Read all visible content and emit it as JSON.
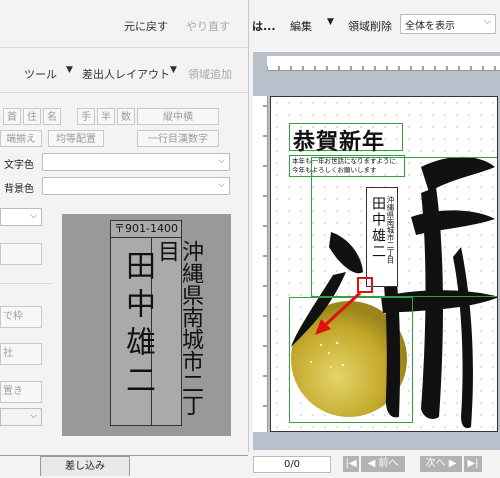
{
  "left_toolbar": {
    "undo": "元に戻す",
    "redo": "やり直す",
    "tool": "ツール",
    "sender_layout": "差出人レイアウト",
    "add_area": "領域追加"
  },
  "format_buttons": [
    "首",
    "住",
    "名",
    "手",
    "半",
    "数",
    "縦中横",
    "端揃え",
    "均等配置",
    "一行目漢数字"
  ],
  "fields": {
    "text_color": "文字色",
    "bg_color": "背景色"
  },
  "side_buttons": [
    "で枠",
    "社",
    "置き"
  ],
  "preview": {
    "zip": "〒901-1400",
    "name": "田中雄二",
    "address": "沖縄県南城市二丁目"
  },
  "bottom_tab": "差し込み",
  "right_toolbar": {
    "file_menu": "は...",
    "edit_menu": "編集",
    "delete_area": "領域削除",
    "view_select": "全体を表示"
  },
  "card_canvas": {
    "greeting_title": "恭賀新年",
    "greeting_line1": "本年も一年お世話になりますように",
    "greeting_line2": "今年もよろしくお願いします",
    "mini_name": "田中雄二",
    "mini_address": "沖縄県南城市二丁目",
    "big_char": "羊"
  },
  "pager": {
    "page": "0/0",
    "prev": "◀ 前へ",
    "next": "次へ ▶",
    "first": "|◀",
    "last": "▶|"
  },
  "colors": {
    "accent_green": "#2ea043",
    "arrow_red": "#e01010",
    "gold": "#c8b02a"
  }
}
